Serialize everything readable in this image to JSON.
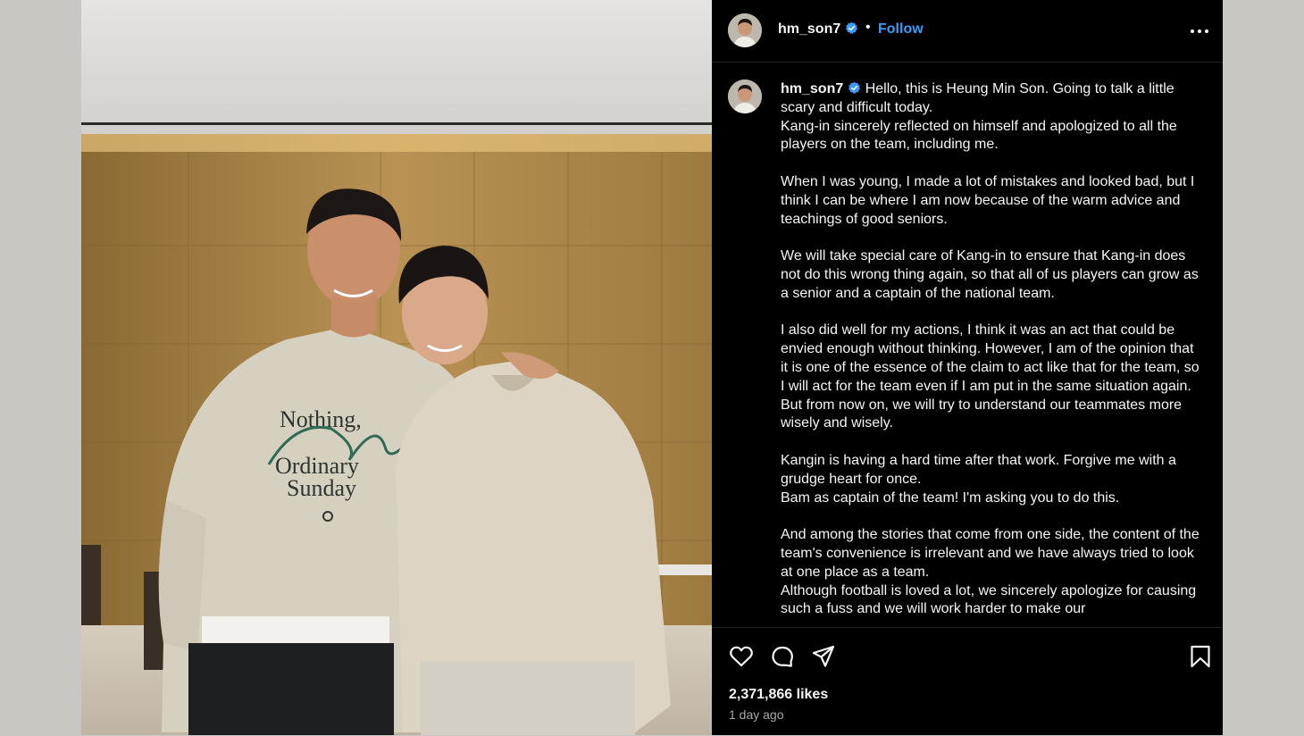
{
  "post": {
    "username": "hm_son7",
    "separator": "•",
    "follow_label": "Follow",
    "more_icon": "more-horizontal-icon",
    "caption_lines": [
      "Hello, this is Heung Min Son. Going to talk a little scary and difficult today.\nKang-in sincerely reflected on himself and apologized to all the players on the team, including me.",
      "When I was young, I made a lot of mistakes and looked bad, but I think I can be where I am now because of the warm advice and teachings of good seniors.",
      "We will take special care of Kang-in to ensure that Kang-in does not do this wrong thing again, so that all of us players can grow as a senior and a captain of the national team.",
      "I also did well for my actions, I think it was an act that could be envied enough without thinking. However, I am of the opinion that it is one of the essence of the claim to act like that for the team, so I will act for the team even if I am put in the same situation again. But from now on, we will try to understand our teammates more wisely and wisely.",
      "Kangin is having a hard time after that work. Forgive me with a grudge heart for once.\nBam as captain of the team! I'm asking you to do this.",
      "And among the stories that come from one side, the content of the team's convenience is irrelevant and we have always tried to look at one place as a team.\nAlthough football is loved a lot, we sincerely apologize for causing such a fuss and we will work harder to make our"
    ],
    "likes": "2,371,866 likes",
    "posted": "1 day ago",
    "photo_sweatshirt_text": [
      "Nothing,",
      "Ordinary",
      "Sunday"
    ],
    "colors": {
      "panel_bg": "#000000",
      "link_blue": "#3d9bf5",
      "muted": "#a8a8a8",
      "verified_blue": "#3d9bf5"
    }
  }
}
